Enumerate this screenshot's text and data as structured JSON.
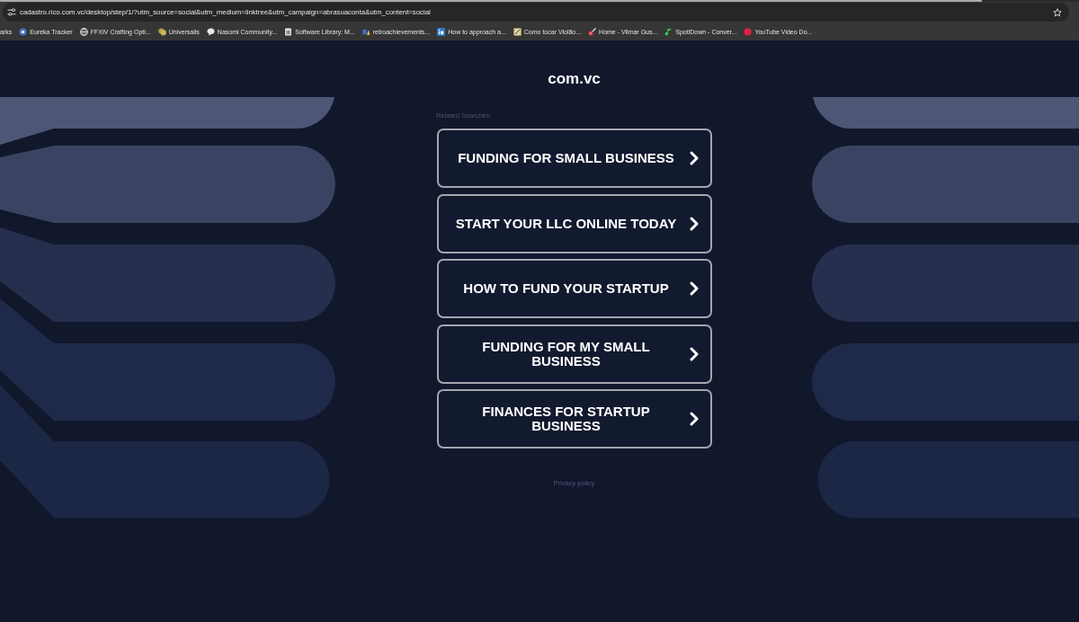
{
  "browser": {
    "loading_bar": {
      "level": 0.91
    },
    "address_bar": {
      "url": "cadastro.rico.com.vc/desktop/step/1/?utm_source=social&utm_medium=linktree&utm_campaign=abrasuaconta&utm_content=social"
    },
    "bookmarks": [
      {
        "label": "arks"
      },
      {
        "label": "Eureka Tracker"
      },
      {
        "label": "FFXIV Crafting Opti..."
      },
      {
        "label": "Universalis"
      },
      {
        "label": "Nasomi Community..."
      },
      {
        "label": "Software Library: M..."
      },
      {
        "label": "retroachievements..."
      },
      {
        "label": "How to approach a..."
      },
      {
        "label": "Como tocar Violão..."
      },
      {
        "label": "Home - Vilmar Gus..."
      },
      {
        "label": "SpotiDown - Conver..."
      },
      {
        "label": "YouTube Video Do..."
      }
    ]
  },
  "page": {
    "site_title": "com.vc",
    "related_label": "Related Searches:",
    "searches": [
      {
        "label": "FUNDING FOR SMALL BUSINESS"
      },
      {
        "label": "START YOUR LLC ONLINE TODAY"
      },
      {
        "label": "HOW TO FUND YOUR STARTUP"
      },
      {
        "label": "FUNDING FOR MY SMALL BUSINESS"
      },
      {
        "label": "FINANCES FOR STARTUP BUSINESS"
      }
    ],
    "footer_link": "Privacy policy"
  }
}
